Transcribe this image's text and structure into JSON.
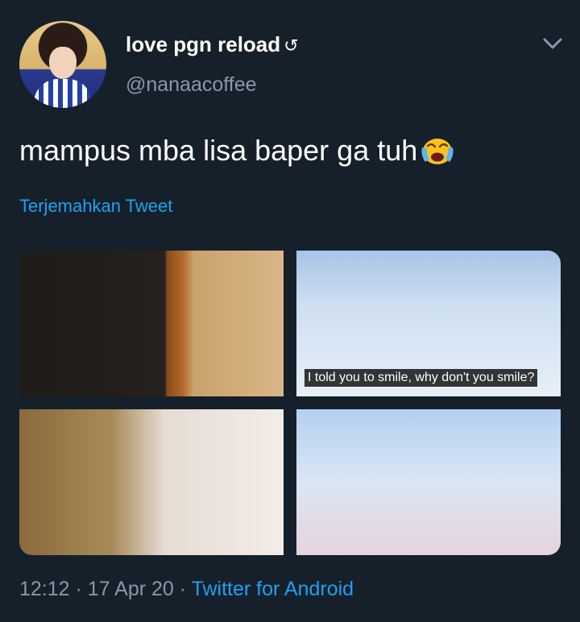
{
  "user": {
    "display_name": "love pgn reload",
    "name_suffix": "↺",
    "handle": "@nanaacoffee"
  },
  "tweet": {
    "text": "mampus mba lisa baper ga tuh",
    "emoji": "loudly-crying-face",
    "translate_label": "Terjemahkan Tweet"
  },
  "media": {
    "images": [
      {
        "name": "photo-1",
        "caption": ""
      },
      {
        "name": "photo-2",
        "caption": "I told you to smile, why don't you smile?"
      },
      {
        "name": "photo-3",
        "caption": ""
      },
      {
        "name": "photo-4",
        "caption": ""
      }
    ]
  },
  "footer": {
    "time": "12:12",
    "separator": " · ",
    "date": "17 Apr 20",
    "source": "Twitter for Android"
  },
  "colors": {
    "background": "#15202b",
    "text_primary": "#ffffff",
    "text_secondary": "#8899a6",
    "link": "#1da1f2"
  }
}
